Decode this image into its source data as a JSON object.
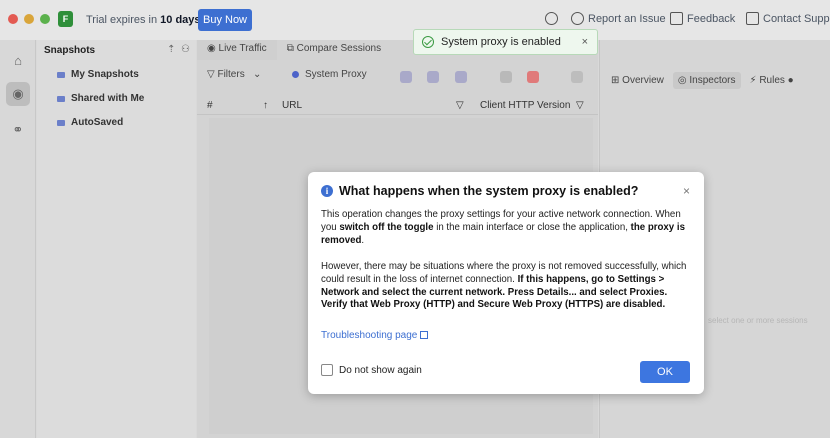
{
  "topbar": {
    "logo_glyph": "F",
    "trial_prefix": "Trial expires in ",
    "trial_days": "10 days!",
    "buy_label": "Buy Now",
    "report_label": "Report an Issue",
    "feedback_label": "Feedback",
    "contact_label": "Contact Suppo"
  },
  "sidebar": {
    "title": "Snapshots",
    "items": [
      {
        "label": "My Snapshots"
      },
      {
        "label": "Shared with Me"
      },
      {
        "label": "AutoSaved"
      }
    ]
  },
  "main": {
    "tabs": [
      {
        "label": "Live Traffic"
      },
      {
        "label": "Compare Sessions"
      }
    ],
    "filters_label": "Filters",
    "system_proxy_label": "System Proxy",
    "columns": {
      "index": "#",
      "url": "URL",
      "client_http": "Client HTTP Version"
    }
  },
  "right_pane": {
    "tabs": [
      {
        "label": "Overview"
      },
      {
        "label": "Inspectors"
      },
      {
        "label": "Rules"
      }
    ],
    "faint_text": "select one or more sessions"
  },
  "toast": {
    "message": "System proxy is enabled",
    "close": "×"
  },
  "modal": {
    "title": "What happens when the system proxy is enabled?",
    "close": "×",
    "p1_a": "This operation changes the proxy settings for your active network connection. When you ",
    "p1_b": "switch off the toggle",
    "p1_c": " in the main interface or close the application, ",
    "p1_d": "the proxy is removed",
    "p1_e": ".",
    "p2_a": "However, there may be situations where the proxy is not removed successfully, which could result in the loss of internet connection. ",
    "p2_b": "If this happens, go to Settings > Network and select the current network. Press Details... and select Proxies. Verify that Web Proxy (HTTP) and Secure Web Proxy (HTTPS) are disabled.",
    "link": "Troubleshooting page",
    "checkbox_label": "Do not show again",
    "ok_label": "OK"
  },
  "colors": {
    "accent": "#3d6fd1",
    "success": "#3a9a42",
    "toast_bg": "#eef7ee"
  }
}
